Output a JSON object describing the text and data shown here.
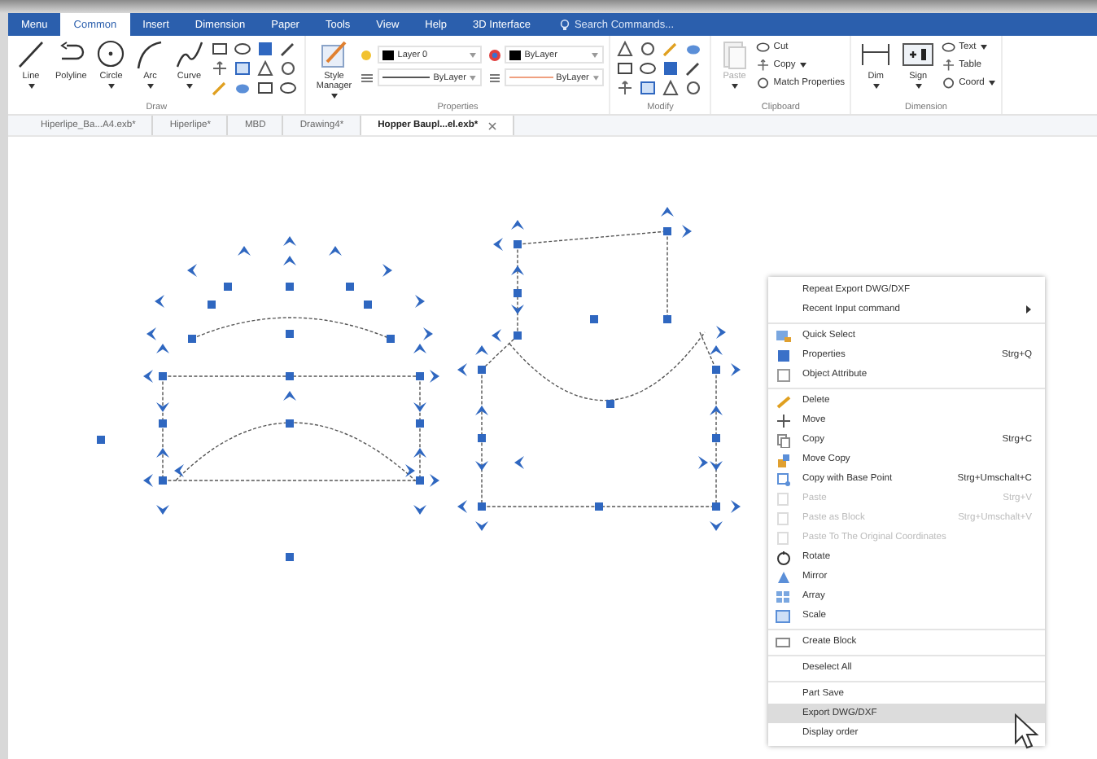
{
  "menubar": {
    "tabs": [
      {
        "label": "Menu",
        "selected": false
      },
      {
        "label": "Common",
        "selected": true
      },
      {
        "label": "Insert",
        "selected": false
      },
      {
        "label": "Dimension",
        "selected": false
      },
      {
        "label": "Paper",
        "selected": false
      },
      {
        "label": "Tools",
        "selected": false
      },
      {
        "label": "View",
        "selected": false
      },
      {
        "label": "Help",
        "selected": false
      },
      {
        "label": "3D Interface",
        "selected": false
      }
    ],
    "search": {
      "placeholder": "Search Commands..."
    }
  },
  "ribbon": {
    "groups": [
      {
        "label": "Draw",
        "tools": [
          {
            "kind": "large",
            "label": "Line",
            "dropdown": true
          },
          {
            "kind": "large",
            "label": "Polyline",
            "dropdown": false
          },
          {
            "kind": "large",
            "label": "Circle",
            "dropdown": true
          },
          {
            "kind": "large",
            "label": "Arc",
            "dropdown": true
          },
          {
            "kind": "large",
            "label": "Curve",
            "dropdown": true
          },
          {
            "kind": "icon-grid"
          }
        ]
      },
      {
        "label": "Properties",
        "tools": [
          {
            "kind": "large",
            "label": "Style Manager",
            "dropdown": true
          },
          {
            "kind": "combos",
            "values": [
              "Layer 0",
              "ByLayer",
              "ByLayer",
              "ByLayer"
            ]
          }
        ]
      },
      {
        "label": "Modify",
        "tools": [
          {
            "kind": "icon-grid"
          }
        ]
      },
      {
        "label": "Clipboard",
        "tools": [
          {
            "kind": "large",
            "label": "Paste",
            "dropdown": true,
            "disabled": true
          },
          {
            "kind": "stack",
            "items": [
              {
                "label": "Cut",
                "dropdown": false
              },
              {
                "label": "Copy",
                "dropdown": true
              },
              {
                "label": "Match Properties",
                "dropdown": false
              }
            ]
          }
        ]
      },
      {
        "label": "Dimension",
        "tools": [
          {
            "kind": "large",
            "label": "Dim",
            "dropdown": true
          },
          {
            "kind": "large",
            "label": "Sign",
            "dropdown": true
          },
          {
            "kind": "stack",
            "items": [
              {
                "label": "Text",
                "dropdown": true
              },
              {
                "label": "Table",
                "dropdown": false
              },
              {
                "label": "Coord",
                "dropdown": true
              }
            ]
          }
        ]
      }
    ]
  },
  "documents": [
    {
      "label": "Hiperlipe_Ba...A4.exb*",
      "selected": false
    },
    {
      "label": "Hiperlipe*",
      "selected": false
    },
    {
      "label": "MBD",
      "selected": false
    },
    {
      "label": "Drawing4*",
      "selected": false
    },
    {
      "label": "Hopper Baupl...el.exb*",
      "selected": true
    }
  ],
  "context_menu": {
    "groups": [
      [
        {
          "label": "Repeat Export DWG/DXF",
          "icon": false,
          "disabled": false,
          "submenu": false,
          "selected": false
        },
        {
          "label": "Recent Input command",
          "icon": false,
          "disabled": false,
          "submenu": true,
          "selected": false
        }
      ],
      [
        {
          "label": "Quick Select",
          "icon": true,
          "disabled": false,
          "submenu": false,
          "selected": false
        },
        {
          "label": "Properties",
          "shortcut": "Strg+Q",
          "icon": true,
          "disabled": false,
          "submenu": false,
          "selected": false
        },
        {
          "label": "Object Attribute",
          "icon": true,
          "disabled": false,
          "submenu": false,
          "selected": false
        }
      ],
      [
        {
          "label": "Delete",
          "icon": true,
          "disabled": false,
          "submenu": false,
          "selected": false
        },
        {
          "label": "Move",
          "icon": true,
          "disabled": false,
          "submenu": false,
          "selected": false
        },
        {
          "label": "Copy",
          "shortcut": "Strg+C",
          "icon": true,
          "disabled": false,
          "submenu": false,
          "selected": false
        },
        {
          "label": "Move Copy",
          "icon": true,
          "disabled": false,
          "submenu": false,
          "selected": false
        },
        {
          "label": "Copy with Base Point",
          "shortcut": "Strg+Umschalt+C",
          "icon": true,
          "disabled": false,
          "submenu": false,
          "selected": false
        },
        {
          "label": "Paste",
          "shortcut": "Strg+V",
          "icon": true,
          "disabled": true,
          "submenu": false,
          "selected": false
        },
        {
          "label": "Paste as Block",
          "shortcut": "Strg+Umschalt+V",
          "icon": true,
          "disabled": true,
          "submenu": false,
          "selected": false
        },
        {
          "label": "Paste To The Original Coordinates",
          "icon": true,
          "disabled": true,
          "submenu": false,
          "selected": false
        },
        {
          "label": "Rotate",
          "icon": true,
          "disabled": false,
          "submenu": false,
          "selected": false
        },
        {
          "label": "Mirror",
          "icon": true,
          "disabled": false,
          "submenu": false,
          "selected": false
        },
        {
          "label": "Array",
          "icon": true,
          "disabled": false,
          "submenu": false,
          "selected": false
        },
        {
          "label": "Scale",
          "icon": true,
          "disabled": false,
          "submenu": false,
          "selected": false
        }
      ],
      [
        {
          "label": "Create Block",
          "icon": true,
          "disabled": false,
          "submenu": false,
          "selected": false
        }
      ],
      [
        {
          "label": "Deselect All",
          "icon": false,
          "disabled": false,
          "submenu": false,
          "selected": false
        }
      ],
      [
        {
          "label": "Part Save",
          "icon": false,
          "disabled": false,
          "submenu": false,
          "selected": false
        },
        {
          "label": "Export DWG/DXF",
          "icon": false,
          "disabled": false,
          "submenu": false,
          "selected": true
        },
        {
          "label": "Display order",
          "icon": false,
          "disabled": false,
          "selected": false
        }
      ]
    ]
  }
}
